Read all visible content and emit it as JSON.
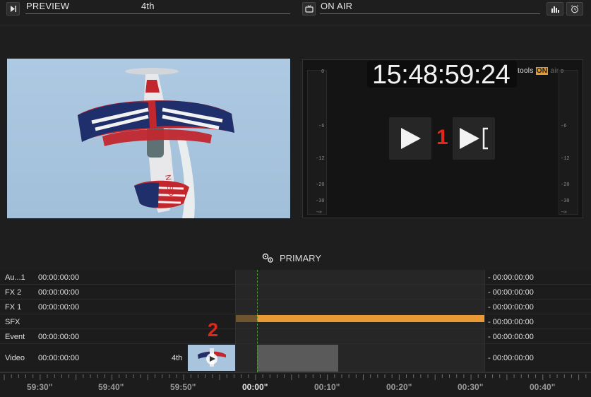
{
  "preview": {
    "title": "PREVIEW",
    "clip_name": "4th",
    "icon": "play-step-icon"
  },
  "onair": {
    "title": "ON AIR",
    "icon": "tv-icon",
    "stats_icon": "bar-chart-icon",
    "clock_icon": "alarm-clock-icon",
    "timecode": "15:48:59:24",
    "brand_prefix": "tools",
    "brand_on": "ON",
    "brand_suffix": "air",
    "meter_ticks": [
      "0",
      "-6",
      "-12",
      "-20",
      "-30",
      "-∞"
    ],
    "annotation": "1"
  },
  "primary": {
    "label": "PRIMARY",
    "icon": "gears-icon"
  },
  "timeline": {
    "tracks": [
      {
        "name": "Au...1",
        "timecode": "00:00:00:00",
        "remaining": "- 00:00:00:00"
      },
      {
        "name": "FX 2",
        "timecode": "00:00:00:00",
        "remaining": "- 00:00:00:00"
      },
      {
        "name": "FX 1",
        "timecode": "00:00:00:00",
        "remaining": "- 00:00:00:00"
      },
      {
        "name": "SFX",
        "timecode": "",
        "remaining": "- 00:00:00:00"
      },
      {
        "name": "Event",
        "timecode": "00:00:00:00",
        "remaining": "- 00:00:00:00"
      },
      {
        "name": "Video",
        "timecode": "00:00:00:00",
        "remaining": "- 00:00:00:00",
        "clip_label": "4th"
      }
    ],
    "annotation": "2",
    "ruler": [
      "59:30\"",
      "59:40\"",
      "59:50\"",
      "00:00\"",
      "00:10\"",
      "00:20\"",
      "00:30\"",
      "00:40\""
    ],
    "sfx_color": "#e99a35",
    "playhead_color": "#4c9a35"
  }
}
